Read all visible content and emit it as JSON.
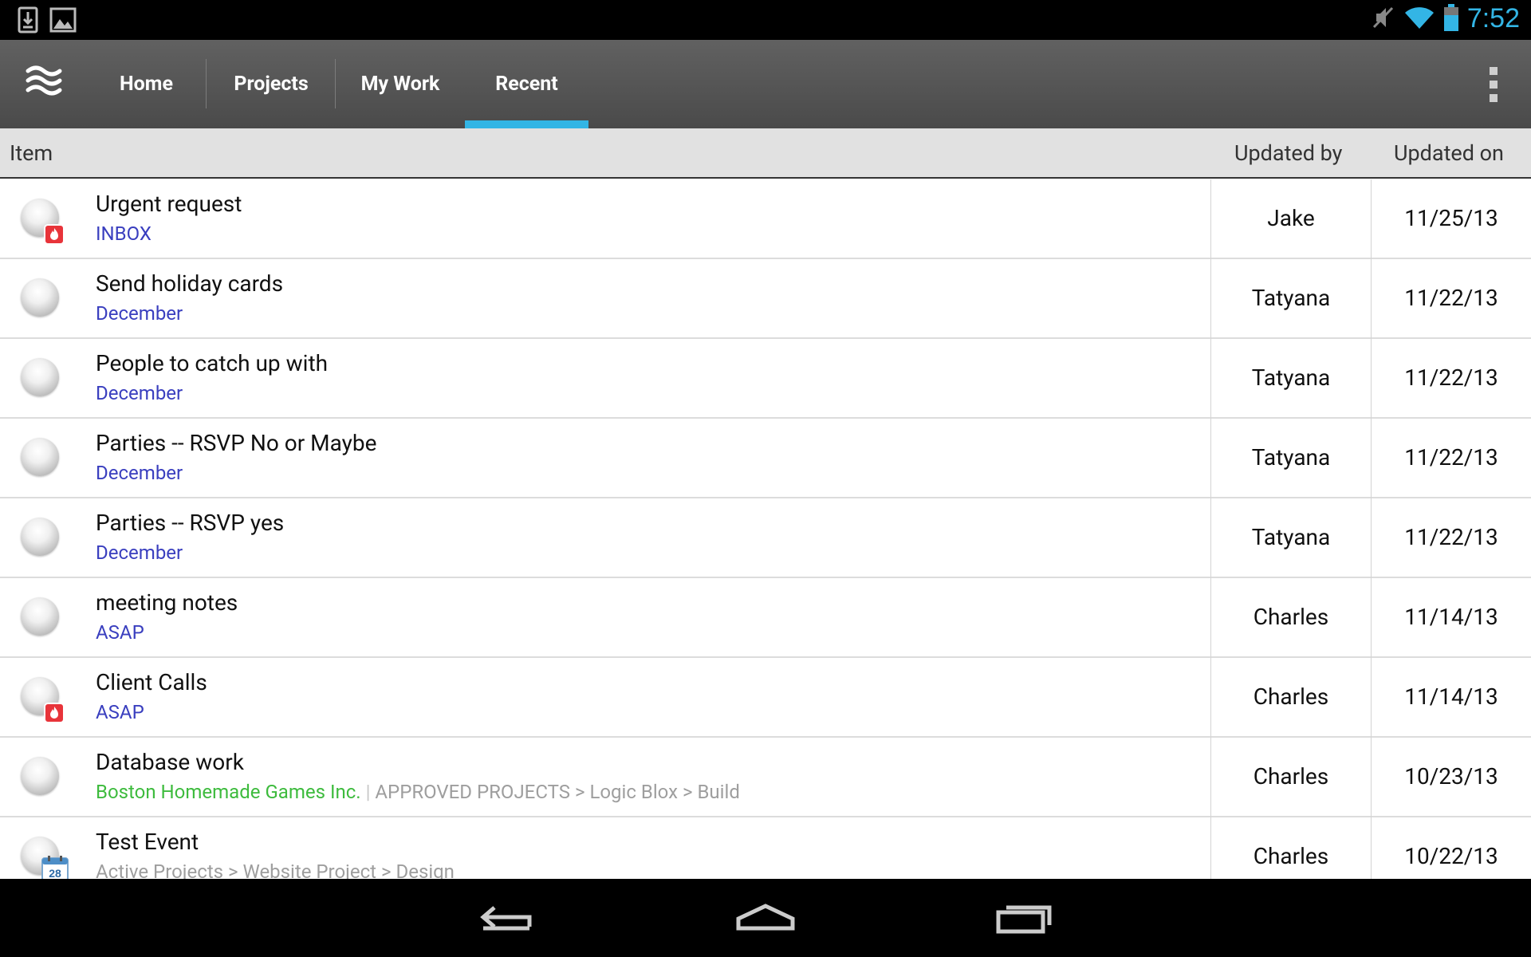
{
  "status_bar": {
    "time": "7:52",
    "left_icons": [
      "download-notification-icon",
      "image-notification-icon"
    ],
    "right_icons": [
      "mute-icon",
      "wifi-icon",
      "battery-icon"
    ],
    "time_color": "#33b5e5"
  },
  "action_bar": {
    "logo_icon": "app-waves-logo-icon",
    "tabs": [
      {
        "label": "Home"
      },
      {
        "label": "Projects"
      },
      {
        "label": "My Work"
      },
      {
        "label": "Recent"
      }
    ],
    "active_tab": "Recent",
    "accent_color": "#33b5e5",
    "overflow_icon": "overflow-menu-icon"
  },
  "table": {
    "headers": {
      "item": "Item",
      "updated_by": "Updated by",
      "updated_on": "Updated on"
    },
    "rows": [
      {
        "title": "Urgent request",
        "project": "INBOX",
        "path": "",
        "updated_by": "Jake",
        "updated_on": "11/25/13",
        "badge": "urgent-fire-icon"
      },
      {
        "title": "Send holiday cards",
        "project": "December",
        "path": "",
        "updated_by": "Tatyana",
        "updated_on": "11/22/13",
        "badge": ""
      },
      {
        "title": "People to catch up with",
        "project": "December",
        "path": "",
        "updated_by": "Tatyana",
        "updated_on": "11/22/13",
        "badge": ""
      },
      {
        "title": "Parties -- RSVP No or Maybe",
        "project": "December",
        "path": "",
        "updated_by": "Tatyana",
        "updated_on": "11/22/13",
        "badge": ""
      },
      {
        "title": "Parties -- RSVP yes",
        "project": "December",
        "path": "",
        "updated_by": "Tatyana",
        "updated_on": "11/22/13",
        "badge": ""
      },
      {
        "title": "meeting notes",
        "project": "ASAP",
        "path": "",
        "updated_by": "Charles",
        "updated_on": "11/14/13",
        "badge": ""
      },
      {
        "title": "Client Calls",
        "project": "ASAP",
        "path": "",
        "updated_by": "Charles",
        "updated_on": "11/14/13",
        "badge": "urgent-fire-icon"
      },
      {
        "title": "Database work",
        "project": "Boston Homemade Games Inc.",
        "path": "APPROVED PROJECTS > Logic Blox > Build",
        "updated_by": "Charles",
        "updated_on": "10/23/13",
        "badge": "",
        "project_color": "#3dbb3d"
      },
      {
        "title": "Test Event",
        "project": "",
        "path": "Active Projects > Website Project > Design",
        "updated_by": "Charles",
        "updated_on": "10/22/13",
        "badge": "calendar-icon",
        "calendar_day": "28"
      }
    ],
    "colors": {
      "project_link": "#3a3fbf",
      "client_link": "#3dbb3d",
      "path_gray": "#9e9e9e"
    }
  },
  "nav_bar": {
    "buttons": [
      "back-icon",
      "home-icon",
      "recent-apps-icon"
    ]
  }
}
